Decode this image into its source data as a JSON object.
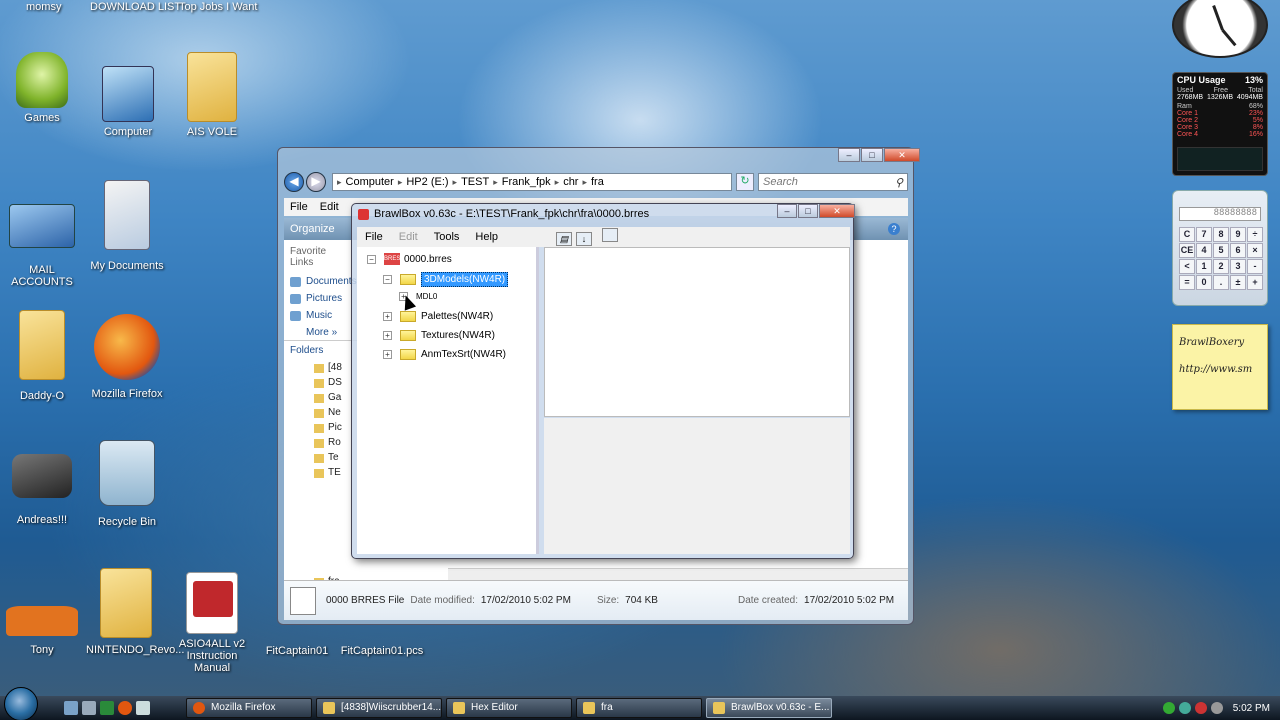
{
  "desktop": {
    "top_labels": [
      "momsy",
      "DOWNLOAD LIST",
      "Top Jobs I Want"
    ],
    "icons": [
      {
        "label": "Games"
      },
      {
        "label": "Computer"
      },
      {
        "label": "AIS VOLE"
      },
      {
        "label": "MAIL ACCOUNTS"
      },
      {
        "label": "My Documents"
      },
      {
        "label": "Daddy-O"
      },
      {
        "label": "Mozilla Firefox"
      },
      {
        "label": "Andreas!!!"
      },
      {
        "label": "Recycle Bin"
      },
      {
        "label": "Tony"
      },
      {
        "label": "NINTENDO_Revo..."
      },
      {
        "label": "ASIO4ALL v2 Instruction Manual"
      },
      {
        "label": "FitCaptain01"
      },
      {
        "label": "FitCaptain01.pcs"
      }
    ]
  },
  "gadgets": {
    "cpu": {
      "title": "CPU Usage",
      "percent": "13%",
      "headers": [
        "Used",
        "Free",
        "Total"
      ],
      "values": [
        "2768MB",
        "1326MB",
        "4094MB"
      ],
      "ram": "Ram",
      "ram_pct": "68%",
      "cores": [
        {
          "name": "Core 1",
          "pct": "23%"
        },
        {
          "name": "Core 2",
          "pct": "5%"
        },
        {
          "name": "Core 3",
          "pct": "8%"
        },
        {
          "name": "Core 4",
          "pct": "16%"
        }
      ]
    },
    "calc": {
      "display": "88888888",
      "keys": [
        "C",
        "7",
        "8",
        "9",
        "÷",
        "CE",
        "4",
        "5",
        "6",
        "×",
        "<",
        "1",
        "2",
        "3",
        "-",
        "=",
        "0",
        ".",
        "±",
        "+"
      ]
    },
    "note": {
      "line1": "BrawlBoxery",
      "line2": "http://www.sm"
    }
  },
  "explorer": {
    "address": [
      "Computer",
      "HP2 (E:)",
      "TEST",
      "Frank_fpk",
      "chr",
      "fra"
    ],
    "search_placeholder": "Search",
    "menu": [
      "File",
      "Edit"
    ],
    "toolbar_organize": "Organize",
    "favorite_links": "Favorite Links",
    "links": [
      "Documents",
      "Pictures",
      "Music"
    ],
    "more": "More",
    "folders_label": "Folders",
    "folder_rows": [
      "[48",
      "DS",
      "Ga",
      "Ne",
      "Pic",
      "Ro",
      "Te",
      "TE"
    ],
    "tree_tail": [
      "fra",
      "cpu"
    ],
    "status": {
      "name": "0000 BRRES File",
      "modified_label": "Date modified:",
      "modified": "17/02/2010 5:02 PM",
      "size_label": "Size:",
      "size": "704 KB",
      "created_label": "Date created:",
      "created": "17/02/2010 5:02 PM"
    }
  },
  "brawlbox": {
    "title": "BrawlBox v0.63c - E:\\TEST\\Frank_fpk\\chr\\fra\\0000.brres",
    "menu": {
      "file": "File",
      "edit": "Edit",
      "tools": "Tools",
      "help": "Help"
    },
    "tree": {
      "root": "0000.brres",
      "root_tag": "BRES",
      "selected": "3DModels(NW4R)",
      "child": "MDL0",
      "items": [
        "Palettes(NW4R)",
        "Textures(NW4R)",
        "AnmTexSrt(NW4R)"
      ]
    }
  },
  "taskbar": {
    "tasks": [
      {
        "label": "Mozilla Firefox"
      },
      {
        "label": "[4838]Wiiscrubber14..."
      },
      {
        "label": "Hex Editor"
      },
      {
        "label": "fra"
      },
      {
        "label": "BrawlBox v0.63c - E..."
      }
    ],
    "time": "5:02 PM"
  }
}
